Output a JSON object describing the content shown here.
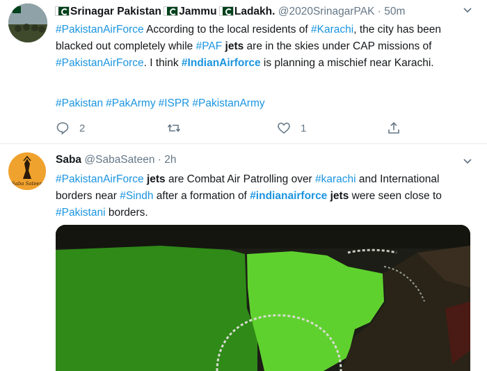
{
  "tweet1": {
    "header": {
      "name_parts": [
        "Srinagar Pakistan",
        "Jammu",
        "Ladakh."
      ],
      "handle": "@2020SrinagarPAK",
      "time": "50m"
    },
    "body": {
      "t1": "#PakistanAirForce",
      "t2": " According to the local residents of ",
      "t3": "#Karachi",
      "t4": ", the city has been blacked out completely while ",
      "t5": "#PAF",
      "t6": " jets",
      "t7": " are in the skies under CAP missions of ",
      "t8": "#PakistanAirForce",
      "t9": ". I think ",
      "t10": "#IndianAirforce",
      "t11": " is planning a mischief near Karachi."
    },
    "hashtags": [
      "#Pakistan",
      "#PakArmy",
      "#ISPR",
      "#PakistanArmy"
    ],
    "actions": {
      "replies": "2",
      "likes": "1"
    }
  },
  "tweet2": {
    "header": {
      "name": "Saba",
      "handle": "@SabaSateen",
      "time": "2h"
    },
    "avatar_text": "Saba Sateen",
    "body": {
      "t1": "#PakistanAirForce",
      "t2": " jets",
      "t3": " are Combat Air Patrolling over ",
      "t4": "#karachi",
      "t5": " and International borders near ",
      "t6": "#Sindh",
      "t7": " after a formation of ",
      "t8": "#indianairforce",
      "t9": " jets",
      "t10": " were seen close to ",
      "t11": "#Pakistani",
      "t12": " borders."
    }
  },
  "colors": {
    "link": "#1b95e0",
    "secondary": "#657786",
    "map_green": "#5fd12e",
    "map_dark_green": "#2f8a18"
  },
  "icons": [
    "reply-icon",
    "retweet-icon",
    "like-icon",
    "share-icon",
    "chevron-down-icon",
    "pakistan-flag-icon"
  ]
}
